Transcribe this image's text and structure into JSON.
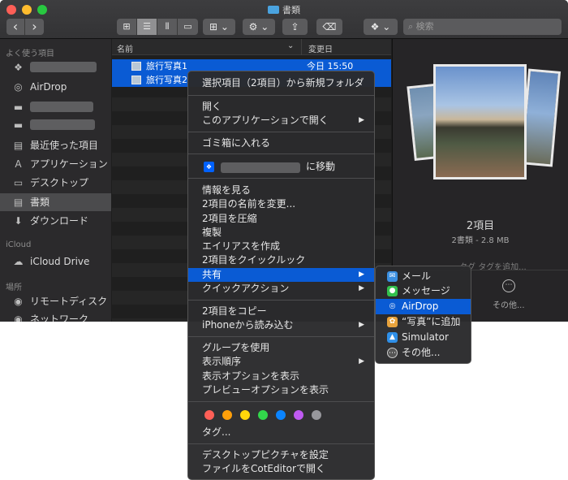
{
  "window": {
    "title": "書類"
  },
  "toolbar": {
    "back": "‹",
    "forward": "›",
    "view_icons": "⊞",
    "view_list": "☰",
    "view_columns": "⫴",
    "view_gallery": "▭",
    "group_icon": "⊞",
    "action_icon": "⚙",
    "share_icon": "⇪",
    "tag_icon": "⌫",
    "dropbox_icon": "❖",
    "chevron": "⌄",
    "search_placeholder": "検索"
  },
  "sidebar": {
    "favorites_header": "よく使う項目",
    "items": [
      {
        "icon": "dropbox-icon",
        "glyph": "❖",
        "label": ""
      },
      {
        "icon": "airdrop-icon",
        "glyph": "◎",
        "label": "AirDrop"
      },
      {
        "icon": "folder-icon",
        "glyph": "▬",
        "label": ""
      },
      {
        "icon": "folder-icon",
        "glyph": "▬",
        "label": ""
      },
      {
        "icon": "recents-icon",
        "glyph": "▤",
        "label": "最近使った項目"
      },
      {
        "icon": "applications-icon",
        "glyph": "A",
        "label": "アプリケーション"
      },
      {
        "icon": "desktop-icon",
        "glyph": "▭",
        "label": "デスクトップ"
      },
      {
        "icon": "documents-icon",
        "glyph": "▤",
        "label": "書類"
      },
      {
        "icon": "downloads-icon",
        "glyph": "⬇",
        "label": "ダウンロード"
      }
    ],
    "icloud_header": "iCloud",
    "icloud_items": [
      {
        "icon": "icloud-icon",
        "glyph": "☁",
        "label": "iCloud Drive"
      }
    ],
    "locations_header": "場所",
    "location_items": [
      {
        "icon": "remote-disc-icon",
        "glyph": "◉",
        "label": "リモートディスク"
      },
      {
        "icon": "network-icon",
        "glyph": "◉",
        "label": "ネットワーク"
      }
    ]
  },
  "filelist": {
    "col_name": "名前",
    "col_date": "変更日",
    "sort_icon": "⌄",
    "rows": [
      {
        "name": "旅行写真1",
        "date": "今日 15:50"
      },
      {
        "name": "旅行写真2",
        "date": ""
      }
    ]
  },
  "preview": {
    "title": "2項目",
    "subtitle": "2書類 - 2.8 MB",
    "tag_label": "タグ",
    "tag_placeholder": "タグを追加...",
    "more_label": "その他...",
    "more_icon": "⋯"
  },
  "context_menu": {
    "new_folder": "選択項目（2項目）から新規フォルダ",
    "open": "開く",
    "open_with": "このアプリケーションで開く",
    "trash": "ゴミ箱に入れる",
    "move_to": "に移動",
    "get_info": "情報を見る",
    "rename": "2項目の名前を変更...",
    "compress": "2項目を圧縮",
    "duplicate": "複製",
    "alias": "エイリアスを作成",
    "quicklook": "2項目をクイックルック",
    "share": "共有",
    "quick_actions": "クイックアクション",
    "copy": "2項目をコピー",
    "import_iphone": "iPhoneから読み込む",
    "use_groups": "グループを使用",
    "sort_by": "表示順序",
    "view_options": "表示オプションを表示",
    "preview_options": "プレビューオプションを表示",
    "tags": "タグ...",
    "tag_colors": [
      "#ff5f57",
      "#ff9f0a",
      "#ffd60a",
      "#32d74b",
      "#0a84ff",
      "#bf5af2",
      "#98989d"
    ],
    "desktop_picture": "デスクトップピクチャを設定",
    "open_coteditor": "ファイルをCotEditorで開く",
    "submenu_arrow": "▶"
  },
  "share_menu": {
    "items": [
      {
        "icon": "mail-icon",
        "glyph": "✉",
        "color": "#3b8fe0",
        "label": "メール"
      },
      {
        "icon": "messages-icon",
        "glyph": "●",
        "color": "#33c14d",
        "label": "メッセージ"
      },
      {
        "icon": "airdrop-icon",
        "glyph": "◎",
        "color": "#0a5bd4",
        "label": "AirDrop"
      },
      {
        "icon": "photos-icon",
        "glyph": "✿",
        "color": "#e8a33d",
        "label": "“写真”に追加"
      },
      {
        "icon": "simulator-icon",
        "glyph": "▲",
        "color": "#2e8fe8",
        "label": "Simulator"
      },
      {
        "icon": "more-icon",
        "glyph": "⋯",
        "color": "#555",
        "label": "その他..."
      }
    ]
  },
  "colors": {
    "accent": "#0a5bd4",
    "window_bg": "#1e1e1e",
    "sidebar_bg": "#2b2a2c"
  }
}
